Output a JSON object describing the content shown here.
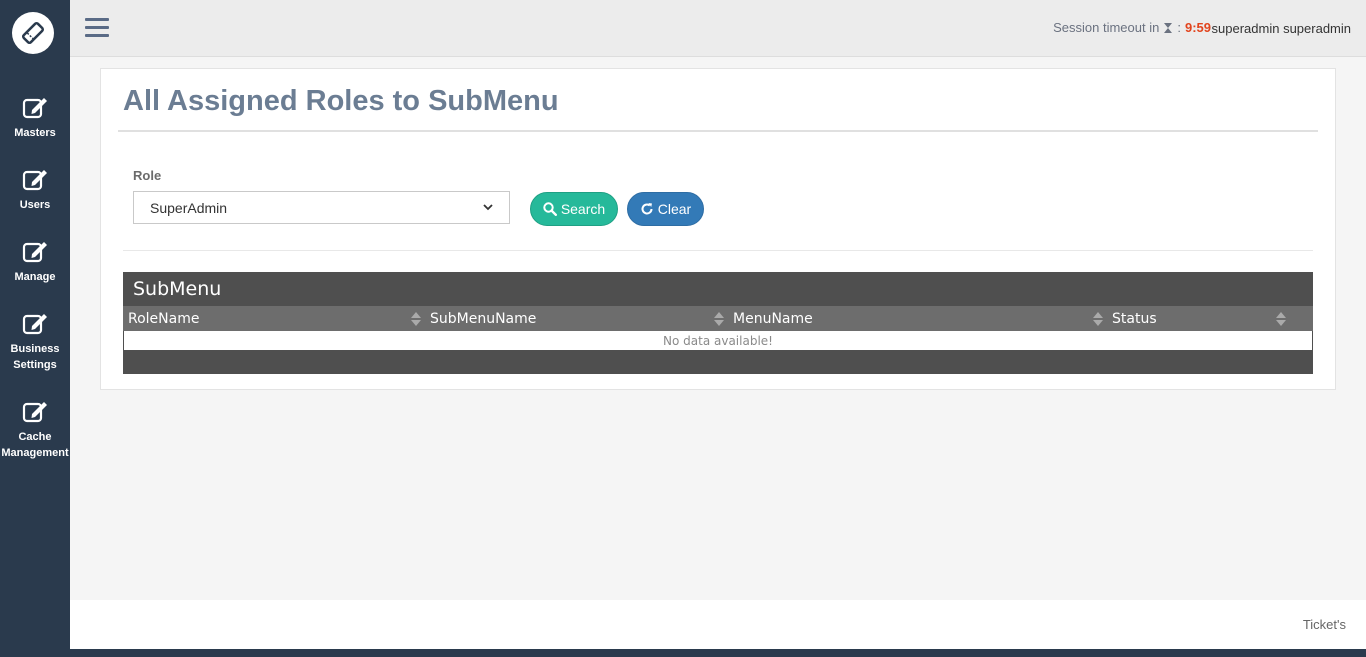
{
  "sidebar": {
    "items": [
      {
        "label": "Masters",
        "icon": "edit-icon"
      },
      {
        "label": "Users",
        "icon": "edit-icon"
      },
      {
        "label": "Manage",
        "icon": "edit-icon"
      },
      {
        "label": "Business Settings",
        "icon": "edit-icon"
      },
      {
        "label": "Cache Management",
        "icon": "edit-icon"
      }
    ]
  },
  "topbar": {
    "session_label": "Session timeout in",
    "session_separator": ":",
    "session_timer": "9:59",
    "username": "superadmin superadmin"
  },
  "page": {
    "title": "All Assigned Roles to SubMenu"
  },
  "form": {
    "role_label": "Role",
    "role_selected": "SuperAdmin",
    "search_label": "Search",
    "clear_label": "Clear"
  },
  "grid": {
    "caption": "SubMenu",
    "columns": [
      "RoleName",
      "SubMenuName",
      "MenuName",
      "Status"
    ],
    "empty_message": "No data available!"
  },
  "footer": {
    "text": "Ticket's"
  },
  "colors": {
    "sidebar": "#2a3a4d",
    "search_button": "#26b99a",
    "clear_button": "#337ab7",
    "timer": "#e2441d",
    "grid_header": "#4f4f4f"
  }
}
